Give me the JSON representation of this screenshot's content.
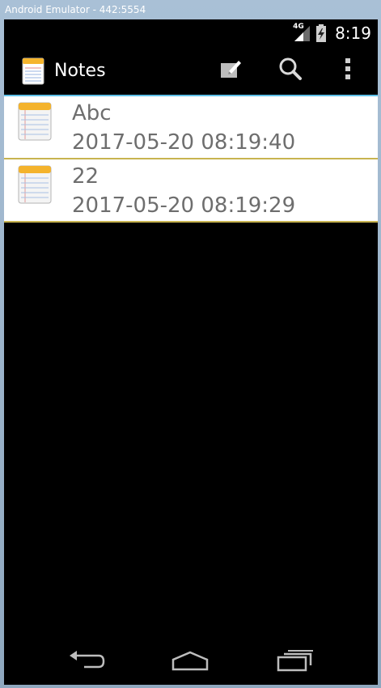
{
  "window": {
    "title": "Android Emulator - 442:5554"
  },
  "statusbar": {
    "network_label": "4G",
    "time": "8:19"
  },
  "actionbar": {
    "title": "Notes",
    "icons": [
      "notepad-app-icon",
      "new-note-icon",
      "search-icon",
      "overflow-menu-icon"
    ]
  },
  "notes": [
    {
      "title": "Abc",
      "date": "2017-05-20 08:19:40"
    },
    {
      "title": "22",
      "date": "2017-05-20 08:19:29"
    }
  ],
  "navbar": {
    "icons": [
      "back-icon",
      "home-icon",
      "recent-apps-icon"
    ]
  },
  "colors": {
    "list_top_accent": "#5fc0e8",
    "row_divider": "#c8b450",
    "note_text": "#6e6e6e"
  }
}
